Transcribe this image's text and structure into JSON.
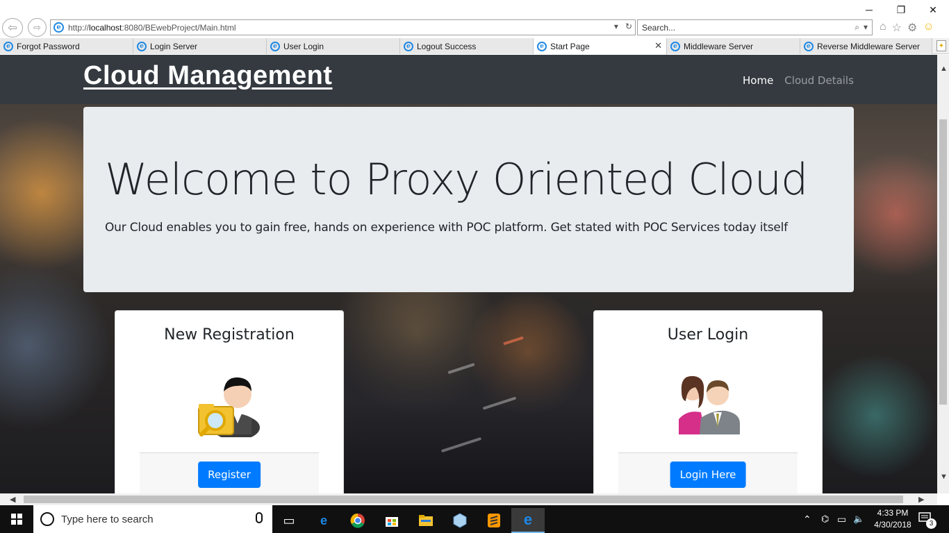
{
  "browser": {
    "window_controls": {
      "minimize": "─",
      "restore": "❐",
      "close": "✕"
    },
    "address": {
      "prefix": "http://",
      "host": "localhost",
      "path": ":8080/BEwebProject/Main.html"
    },
    "search": {
      "placeholder": "Search..."
    },
    "tabs": [
      {
        "label": "Forgot Password",
        "active": false
      },
      {
        "label": "Login Server",
        "active": false
      },
      {
        "label": "User Login",
        "active": false
      },
      {
        "label": "Logout Success",
        "active": false
      },
      {
        "label": "Start Page",
        "active": true
      },
      {
        "label": "Middleware Server",
        "active": false
      },
      {
        "label": "Reverse Middleware Server",
        "active": false
      }
    ]
  },
  "page": {
    "brand": "Cloud Management",
    "nav": [
      {
        "label": "Home",
        "active": true
      },
      {
        "label": "Cloud Details",
        "active": false
      }
    ],
    "jumbotron": {
      "title": "Welcome to Proxy Oriented Cloud",
      "lead": "Our Cloud enables you to gain free, hands on experience with POC platform. Get stated with POC Services today itself"
    },
    "cards": [
      {
        "title": "New Registration",
        "button": "Register",
        "icon": "registration-user-icon"
      },
      {
        "title": "User Login",
        "button": "Login Here",
        "icon": "users-login-icon"
      }
    ]
  },
  "taskbar": {
    "search_placeholder": "Type here to search",
    "time": "4:33 PM",
    "date": "4/30/2018",
    "notification_count": "3"
  },
  "colors": {
    "navbar": "#343a40",
    "jumbotron": "#e9ecef",
    "primary_button": "#007bff",
    "taskbar": "#101010"
  }
}
